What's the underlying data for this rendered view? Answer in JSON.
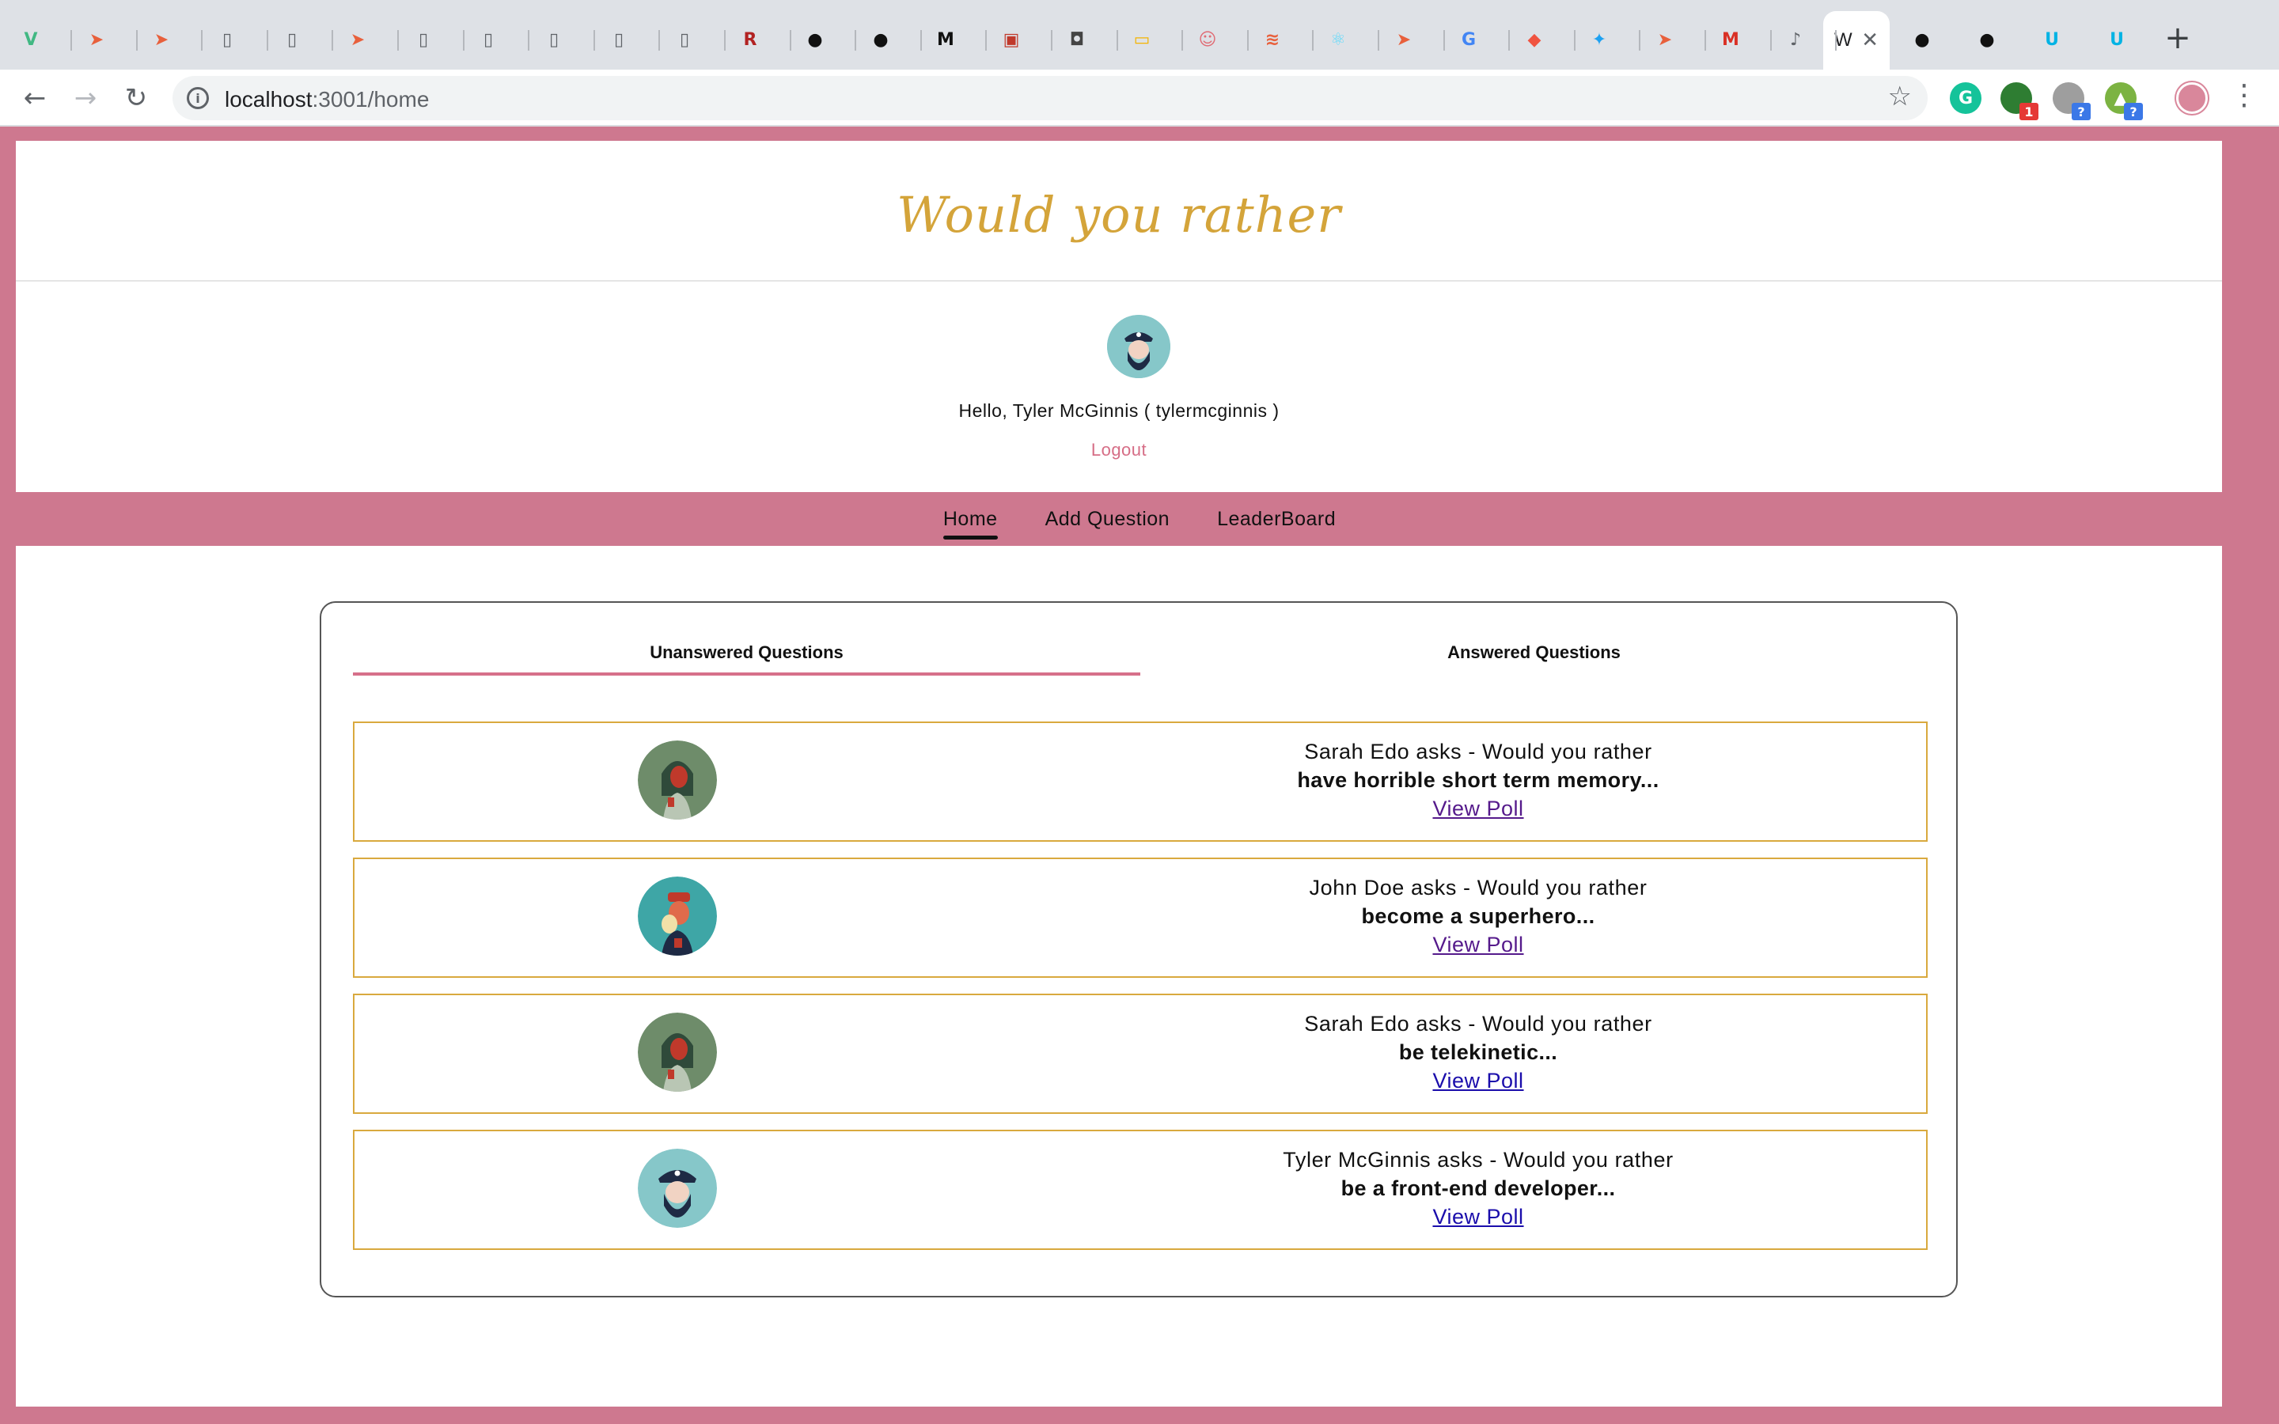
{
  "browser": {
    "active_tab_title": "W",
    "url_host": "localhost",
    "url_path": ":3001/home",
    "tabs": [
      {
        "icon": "vue-icon",
        "glyph": "V",
        "color": "#41b883"
      },
      {
        "icon": "plane-icon",
        "glyph": "➤",
        "color": "#e8603c"
      },
      {
        "icon": "plane-icon",
        "glyph": "➤",
        "color": "#e8603c"
      },
      {
        "icon": "document-icon",
        "glyph": "▯",
        "color": "#5f6368"
      },
      {
        "icon": "document-icon",
        "glyph": "▯",
        "color": "#5f6368"
      },
      {
        "icon": "plane-icon",
        "glyph": "➤",
        "color": "#e8603c"
      },
      {
        "icon": "document-icon",
        "glyph": "▯",
        "color": "#5f6368"
      },
      {
        "icon": "document-icon",
        "glyph": "▯",
        "color": "#5f6368"
      },
      {
        "icon": "document-icon",
        "glyph": "▯",
        "color": "#5f6368"
      },
      {
        "icon": "document-icon",
        "glyph": "▯",
        "color": "#5f6368"
      },
      {
        "icon": "document-icon",
        "glyph": "▯",
        "color": "#5f6368"
      },
      {
        "icon": "rv-icon",
        "glyph": "R",
        "color": "#b22222"
      },
      {
        "icon": "github-icon",
        "glyph": "●",
        "color": "#111111"
      },
      {
        "icon": "github-icon",
        "glyph": "●",
        "color": "#111111"
      },
      {
        "icon": "medium-icon",
        "glyph": "M",
        "color": "#111111"
      },
      {
        "icon": "notification-icon",
        "glyph": "▣",
        "color": "#c0392b"
      },
      {
        "icon": "codepen-icon",
        "glyph": "◘",
        "color": "#444444"
      },
      {
        "icon": "slides-icon",
        "glyph": "▭",
        "color": "#f4b400"
      },
      {
        "icon": "smile-icon",
        "glyph": "☺",
        "color": "#e06c75"
      },
      {
        "icon": "stack-icon",
        "glyph": "≋",
        "color": "#e8603c"
      },
      {
        "icon": "react-icon",
        "glyph": "⚛",
        "color": "#61dafb"
      },
      {
        "icon": "plane-icon",
        "glyph": "➤",
        "color": "#e8603c"
      },
      {
        "icon": "google-icon",
        "glyph": "G",
        "color": "#4285f4"
      },
      {
        "icon": "laravel-icon",
        "glyph": "◆",
        "color": "#f05340"
      },
      {
        "icon": "twitter-icon",
        "glyph": "✦",
        "color": "#1da1f2"
      },
      {
        "icon": "plane-icon",
        "glyph": "➤",
        "color": "#e8603c"
      },
      {
        "icon": "gmail-icon",
        "glyph": "M",
        "color": "#d93025"
      },
      {
        "icon": "audio-icon",
        "glyph": "♪",
        "color": "#5f6368"
      }
    ],
    "right_tabs": [
      {
        "icon": "github-icon",
        "glyph": "●",
        "color": "#111111"
      },
      {
        "icon": "github-icon",
        "glyph": "●",
        "color": "#111111"
      },
      {
        "icon": "udacity-icon",
        "glyph": "U",
        "color": "#02b3e4"
      },
      {
        "icon": "udacity-icon",
        "glyph": "U",
        "color": "#02b3e4"
      }
    ],
    "extensions": [
      {
        "icon": "grammarly-icon",
        "glyph": "G",
        "color": "#15c39a",
        "badge": ""
      },
      {
        "icon": "extension-icon",
        "glyph": "●",
        "color": "#2e7d32",
        "badge": "1"
      },
      {
        "icon": "extension-icon",
        "glyph": "●",
        "color": "#9e9e9e",
        "badge": "?"
      },
      {
        "icon": "extension-icon",
        "glyph": "▲",
        "color": "#7cb342",
        "badge": "?"
      }
    ]
  },
  "app": {
    "brand": "Would you rather",
    "greeting": "Hello, Tyler McGinnis ( tylermcginnis )",
    "logout": "Logout",
    "nav": [
      "Home",
      "Add Question",
      "LeaderBoard"
    ],
    "tabs": {
      "unanswered": "Unanswered Questions",
      "answered": "Answered Questions"
    },
    "questions": [
      {
        "author": "sarahedo",
        "asker": "Sarah Edo asks - Would you rather",
        "preview": "have horrible short term memory...",
        "link": "View Poll",
        "visited": true
      },
      {
        "author": "johndoe",
        "asker": "John Doe asks - Would you rather",
        "preview": "become a superhero...",
        "link": "View Poll",
        "visited": true
      },
      {
        "author": "sarahedo",
        "asker": "Sarah Edo asks - Would you rather",
        "preview": "be telekinetic...",
        "link": "View Poll",
        "visited": false
      },
      {
        "author": "tylermcginnis",
        "asker": "Tyler McGinnis asks - Would you rather",
        "preview": "be a front-end developer...",
        "link": "View Poll",
        "visited": false
      }
    ]
  },
  "colors": {
    "frame_pink": "#ce788f",
    "brand_gold": "#d4a43a",
    "item_border": "#d9a93e",
    "tab_underline": "#d6708a",
    "logout_pink": "#d66d86"
  }
}
